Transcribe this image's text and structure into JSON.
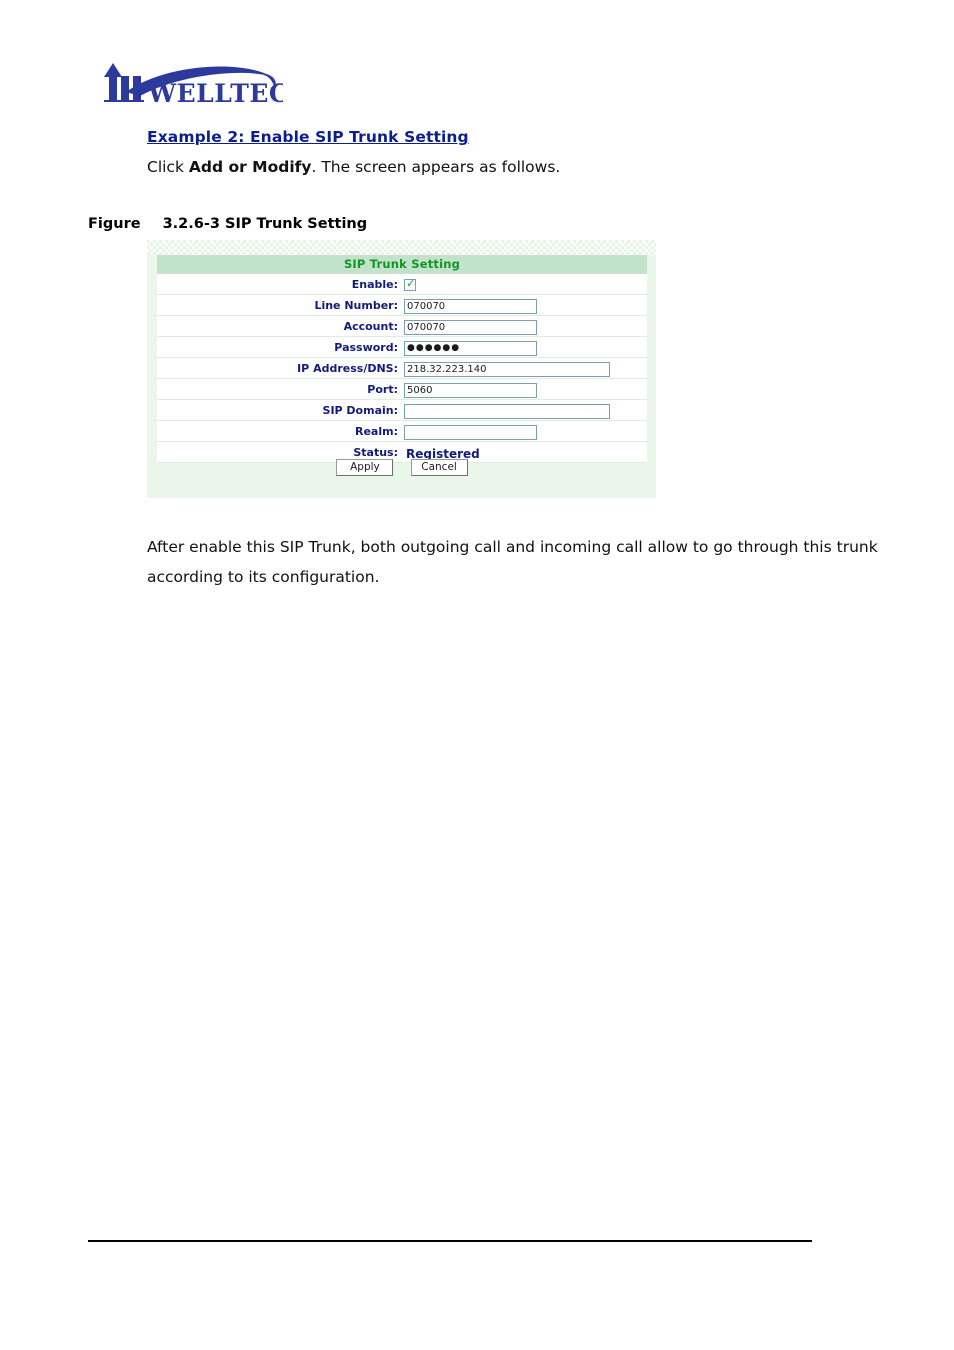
{
  "brand": {
    "logo_text": "WELLTECH",
    "logo_color": "#2c3b9b"
  },
  "document": {
    "example_heading": "Example 2: Enable SIP Trunk Setting",
    "click_prefix": "Click ",
    "click_bold": "Add or Modify",
    "click_suffix": ". The screen appears as follows.",
    "figure_label": "Figure",
    "figure_number_title": "3.2.6-3 SIP Trunk Setting",
    "after_paragraph": "After enable this SIP Trunk, both outgoing call and incoming call allow to go through this trunk according to its configuration."
  },
  "screenshot": {
    "panel_title": "SIP Trunk Setting",
    "header_bg": "#c3e2cc",
    "header_text_color": "#129622",
    "panel_bg": "#eaf6ea",
    "label_color": "#111b79",
    "rows": [
      {
        "label": "Enable:",
        "type": "checkbox",
        "checked": true,
        "check_glyph": "✓"
      },
      {
        "label": "Line Number:",
        "type": "text",
        "value": "070070",
        "width": "std"
      },
      {
        "label": "Account:",
        "type": "text",
        "value": "070070",
        "width": "std"
      },
      {
        "label": "Password:",
        "type": "password",
        "value": "●●●●●●",
        "width": "std"
      },
      {
        "label": "IP Address/DNS:",
        "type": "text",
        "value": "218.32.223.140",
        "width": "wide"
      },
      {
        "label": "Port:",
        "type": "text",
        "value": "5060",
        "width": "std"
      },
      {
        "label": "SIP Domain:",
        "type": "text",
        "value": "",
        "width": "wide"
      },
      {
        "label": "Realm:",
        "type": "text",
        "value": "",
        "width": "std"
      },
      {
        "label": "Status:",
        "type": "status",
        "value": "Registered"
      }
    ],
    "buttons": {
      "apply": "Apply",
      "cancel": "Cancel"
    }
  }
}
